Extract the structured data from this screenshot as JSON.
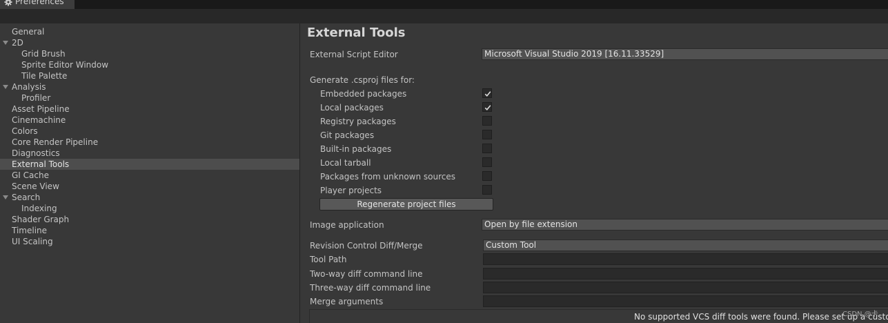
{
  "window": {
    "title": "Preferences"
  },
  "sidebar": {
    "items": [
      {
        "label": "General"
      },
      {
        "label": "2D"
      },
      {
        "label": "Grid Brush"
      },
      {
        "label": "Sprite Editor Window"
      },
      {
        "label": "Tile Palette"
      },
      {
        "label": "Analysis"
      },
      {
        "label": "Profiler"
      },
      {
        "label": "Asset Pipeline"
      },
      {
        "label": "Cinemachine"
      },
      {
        "label": "Colors"
      },
      {
        "label": "Core Render Pipeline"
      },
      {
        "label": "Diagnostics"
      },
      {
        "label": "External Tools",
        "selected": true
      },
      {
        "label": "GI Cache"
      },
      {
        "label": "Scene View"
      },
      {
        "label": "Search"
      },
      {
        "label": "Indexing"
      },
      {
        "label": "Shader Graph"
      },
      {
        "label": "Timeline"
      },
      {
        "label": "UI Scaling"
      }
    ]
  },
  "main": {
    "title": "External Tools",
    "script_editor": {
      "label": "External Script Editor",
      "value": "Microsoft Visual Studio 2019 [16.11.33529]"
    },
    "csproj": {
      "header": "Generate .csproj files for:",
      "options": [
        {
          "label": "Embedded packages",
          "checked": true
        },
        {
          "label": "Local packages",
          "checked": true
        },
        {
          "label": "Registry packages",
          "checked": false
        },
        {
          "label": "Git packages",
          "checked": false
        },
        {
          "label": "Built-in packages",
          "checked": false
        },
        {
          "label": "Local tarball",
          "checked": false
        },
        {
          "label": "Packages from unknown sources",
          "checked": false
        },
        {
          "label": "Player projects",
          "checked": false
        }
      ],
      "regenerate_label": "Regenerate project files"
    },
    "image_application": {
      "label": "Image application",
      "value": "Open by file extension"
    },
    "revision_control": {
      "label": "Revision Control Diff/Merge",
      "value": "Custom Tool"
    },
    "tool_path": {
      "label": "Tool Path",
      "value": ""
    },
    "two_way": {
      "label": "Two-way diff command line",
      "value": ""
    },
    "three_way": {
      "label": "Three-way diff command line",
      "value": ""
    },
    "merge_args": {
      "label": "Merge arguments",
      "value": ""
    },
    "help_message": "No supported VCS diff tools were found. Please set up a custom to"
  },
  "watermark": "CSDN @卡",
  "icons": {
    "tab": "gear-icon",
    "tree_expand": "triangle-down-icon",
    "check": "checkmark-icon"
  }
}
